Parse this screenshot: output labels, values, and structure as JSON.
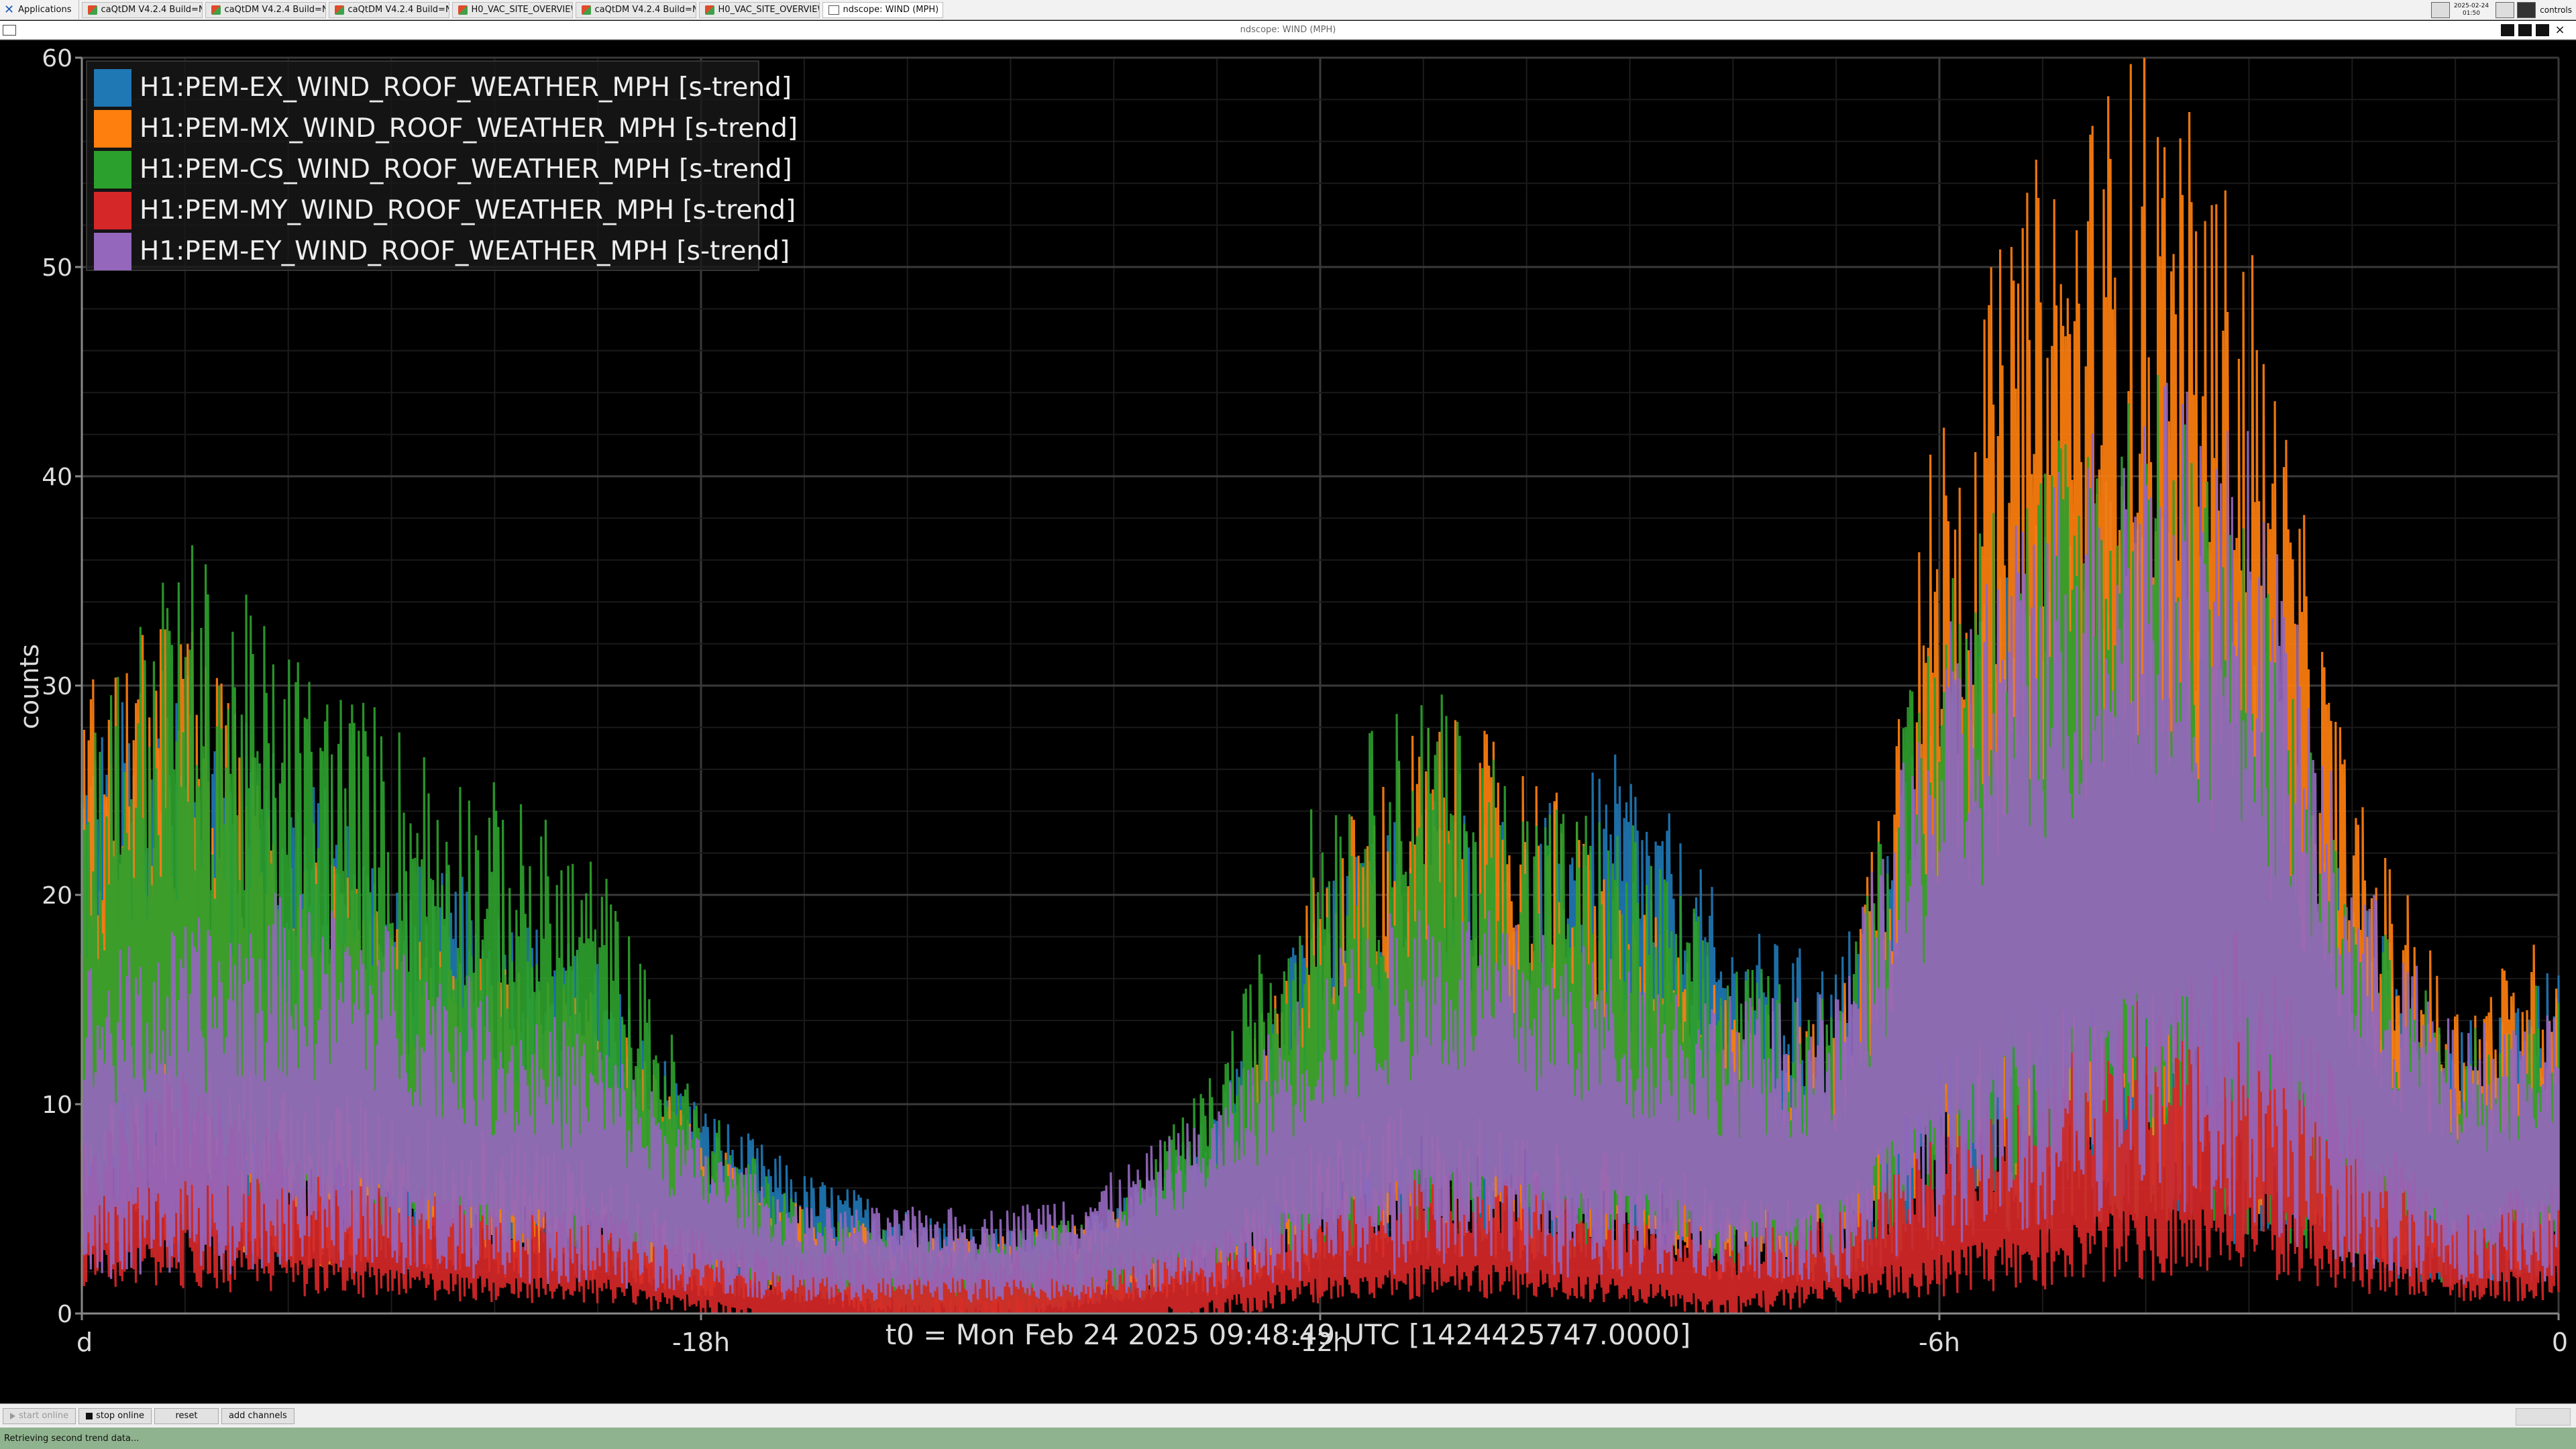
{
  "taskbar": {
    "apps_label": "Applications",
    "tasks": [
      {
        "label": "caQtDM V4.2.4 Build=No...",
        "kind": "qt"
      },
      {
        "label": "caQtDM V4.2.4 Build=No...",
        "kind": "qt"
      },
      {
        "label": "caQtDM V4.2.4 Build=No...",
        "kind": "qt"
      },
      {
        "label": "H0_VAC_SITE_OVERVIEW_...",
        "kind": "qt"
      },
      {
        "label": "caQtDM V4.2.4 Build=No...",
        "kind": "qt"
      },
      {
        "label": "H0_VAC_SITE_OVERVIEW_...",
        "kind": "qt"
      },
      {
        "label": "ndscope: WIND (MPH)",
        "kind": "win"
      }
    ],
    "clock_date": "2025-02-24",
    "clock_time": "01:50",
    "user": "controls"
  },
  "window": {
    "title": "ndscope: WIND (MPH)",
    "close_glyph": "×"
  },
  "legend": [
    {
      "name": "H1:PEM-EX_WIND_ROOF_WEATHER_MPH [s-trend]",
      "color": "#1f77b4"
    },
    {
      "name": "H1:PEM-MX_WIND_ROOF_WEATHER_MPH [s-trend]",
      "color": "#ff7f0e"
    },
    {
      "name": "H1:PEM-CS_WIND_ROOF_WEATHER_MPH [s-trend]",
      "color": "#2ca02c"
    },
    {
      "name": "H1:PEM-MY_WIND_ROOF_WEATHER_MPH [s-trend]",
      "color": "#d62728"
    },
    {
      "name": "H1:PEM-EY_WIND_ROOF_WEATHER_MPH [s-trend]",
      "color": "#9467bd"
    }
  ],
  "chart_data": {
    "type": "line",
    "ylabel": "counts",
    "xlabel": "t0 = Mon Feb 24 2025 09:48:49 UTC [1424425747.0000]",
    "ylim": [
      0,
      60
    ],
    "xlim": [
      -24,
      0
    ],
    "x_unit": "hours relative to t0",
    "yticks": [
      {
        "v": 0,
        "label": "0"
      },
      {
        "v": 10,
        "label": "10"
      },
      {
        "v": 20,
        "label": "20"
      },
      {
        "v": 30,
        "label": "30"
      },
      {
        "v": 40,
        "label": "40"
      },
      {
        "v": 50,
        "label": "50"
      },
      {
        "v": 60,
        "label": "60"
      }
    ],
    "xticks": [
      {
        "v": -24,
        "label": "d"
      },
      {
        "v": -18,
        "label": "-18h"
      },
      {
        "v": -12,
        "label": "-12h"
      },
      {
        "v": -6,
        "label": "-6h"
      },
      {
        "v": 0,
        "label": "0"
      }
    ],
    "grid": true,
    "legend_position": "top-left",
    "x": [
      -24,
      -23,
      -22,
      -21,
      -20,
      -19,
      -18,
      -17,
      -16,
      -15,
      -14,
      -13,
      -12,
      -11,
      -10,
      -9,
      -8,
      -7,
      -6,
      -5,
      -4,
      -3,
      -2,
      -1,
      0
    ],
    "series": [
      {
        "name": "H1:PEM-EX_WIND_ROOF_WEATHER_MPH [s-trend]",
        "color": "#1f77b4",
        "values": [
          17,
          18,
          16,
          13,
          12,
          10,
          6,
          4,
          3,
          2,
          3,
          6,
          12,
          15,
          14,
          16,
          11,
          10,
          18,
          23,
          24,
          20,
          12,
          8,
          10
        ]
      },
      {
        "name": "H1:PEM-MX_WIND_ROOF_WEATHER_MPH [s-trend]",
        "color": "#ff7f0e",
        "values": [
          18,
          20,
          14,
          11,
          10,
          9,
          5,
          3,
          2,
          2,
          3,
          5,
          13,
          17,
          16,
          12,
          9,
          8,
          26,
          33,
          36,
          31,
          15,
          9,
          11
        ]
      },
      {
        "name": "H1:PEM-CS_WIND_ROOF_WEATHER_MPH [s-trend]",
        "color": "#2ca02c",
        "values": [
          17,
          22,
          19,
          17,
          15,
          13,
          6,
          3,
          2,
          2,
          3,
          7,
          15,
          18,
          15,
          14,
          10,
          9,
          21,
          25,
          27,
          23,
          12,
          8,
          10
        ]
      },
      {
        "name": "H1:PEM-MY_WIND_ROOF_WEATHER_MPH [s-trend]",
        "color": "#d62728",
        "values": [
          5,
          7,
          5,
          4,
          3,
          3,
          2,
          1,
          1,
          1,
          1,
          2,
          3,
          4,
          4,
          3,
          2,
          3,
          5,
          7,
          9,
          11,
          6,
          3,
          4
        ]
      },
      {
        "name": "H1:PEM-EY_WIND_ROOF_WEATHER_MPH [s-trend]",
        "color": "#9467bd",
        "values": [
          10,
          11,
          12,
          11,
          9,
          8,
          5,
          3,
          3,
          3,
          4,
          6,
          10,
          12,
          11,
          10,
          9,
          9,
          19,
          24,
          27,
          25,
          13,
          8,
          9
        ]
      }
    ]
  },
  "toolbar": {
    "buttons": [
      {
        "id": "start-online",
        "label": "start online",
        "disabled": true
      },
      {
        "id": "stop-online",
        "label": "stop online",
        "disabled": false
      },
      {
        "id": "reset",
        "label": "reset",
        "disabled": false
      },
      {
        "id": "add-channels",
        "label": "add channels",
        "disabled": false
      }
    ]
  },
  "status": {
    "message": "Retrieving second trend data..."
  }
}
